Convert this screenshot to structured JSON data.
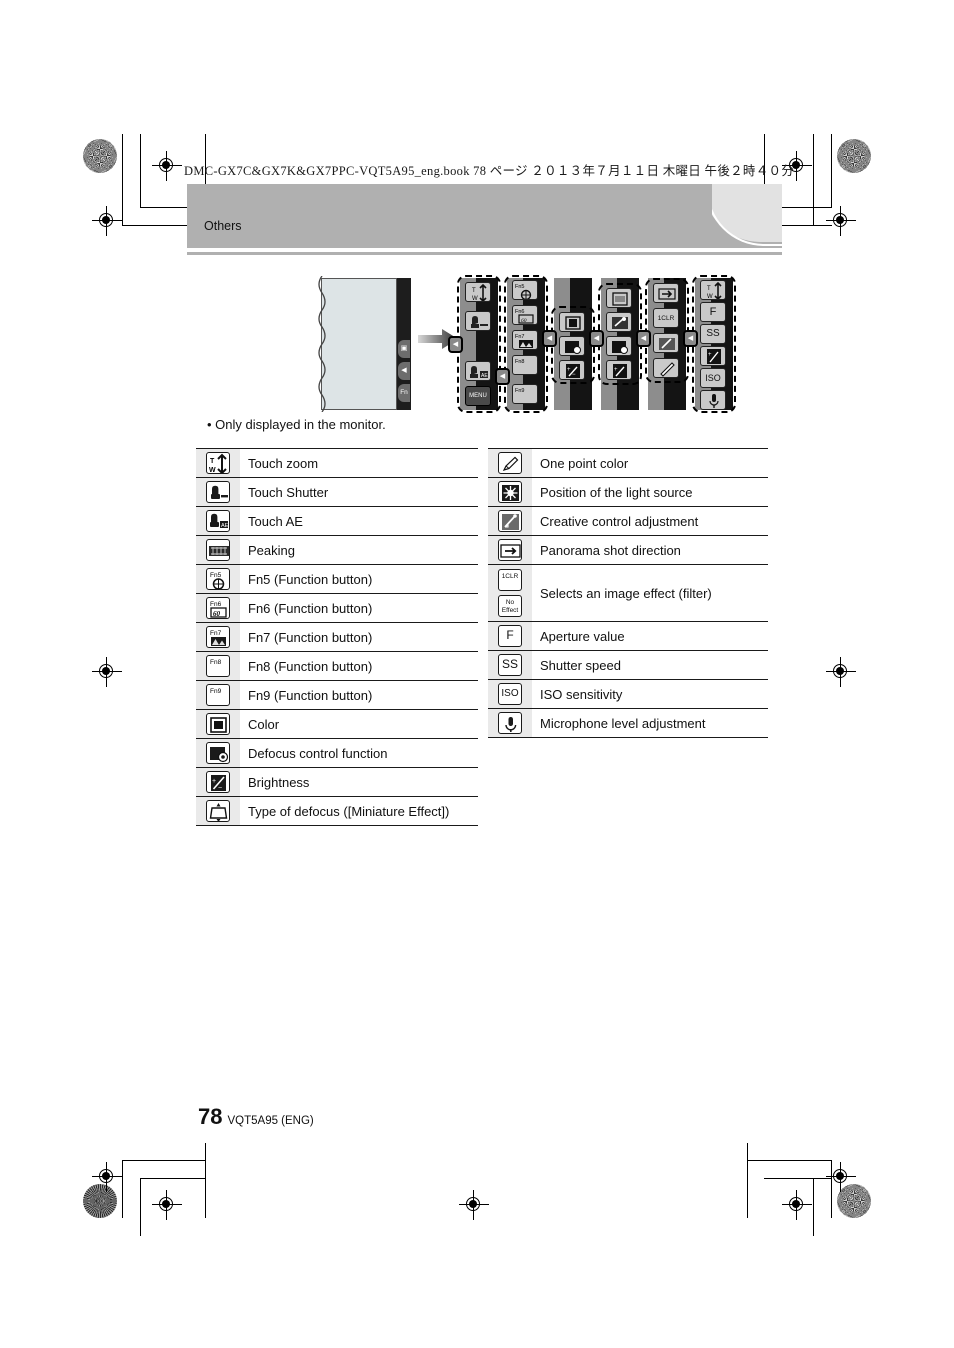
{
  "header": {
    "book_line": "DMC-GX7C&GX7K&GX7PPC-VQT5A95_eng.book   78 ページ   ２０１３年７月１１日   木曜日   午後２時４０分",
    "section": "Others"
  },
  "figure": {
    "monitor_buttons": [
      "▣",
      "◀",
      "Fn"
    ],
    "arrow": "arrow-right",
    "columns": [
      {
        "name": "column-1",
        "icons": [
          "T/W",
          "touch-shutter",
          "touch-ae",
          "MENU"
        ]
      },
      {
        "name": "column-2",
        "icons": [
          "Fn5",
          "Fn6",
          "Fn7",
          "Fn8",
          "Fn9"
        ]
      },
      {
        "name": "column-3",
        "icons": [
          "color",
          "defocus",
          "brightness"
        ]
      },
      {
        "name": "column-4",
        "icons": [
          "miniature",
          "one-point-color",
          "defocus",
          "brightness"
        ]
      },
      {
        "name": "column-5",
        "icons": [
          "panorama",
          "1CLR",
          "creative",
          "pen"
        ]
      },
      {
        "name": "column-6",
        "icons": [
          "T/W",
          "F",
          "SS",
          "EV",
          "ISO",
          "mic"
        ]
      }
    ]
  },
  "note": "• Only displayed in the monitor.",
  "left_table": {
    "rows": [
      {
        "icon": "touch-zoom-icon",
        "label": "Touch zoom"
      },
      {
        "icon": "touch-shutter-icon",
        "label": "Touch Shutter"
      },
      {
        "icon": "touch-ae-icon",
        "label": "Touch AE"
      },
      {
        "icon": "peaking-icon",
        "label": "Peaking"
      },
      {
        "icon": "fn5-icon",
        "label": "Fn5 (Function button)"
      },
      {
        "icon": "fn6-icon",
        "label": "Fn6 (Function button)"
      },
      {
        "icon": "fn7-icon",
        "label": "Fn7 (Function button)"
      },
      {
        "icon": "fn8-icon",
        "label": "Fn8 (Function button)"
      },
      {
        "icon": "fn9-icon",
        "label": "Fn9 (Function button)"
      },
      {
        "icon": "color-icon",
        "label": "Color"
      },
      {
        "icon": "defocus-control-icon",
        "label": "Defocus control function"
      },
      {
        "icon": "brightness-icon",
        "label": "Brightness"
      },
      {
        "icon": "type-of-defocus-icon",
        "label": "Type of defocus ([Miniature Effect])"
      }
    ]
  },
  "right_table": {
    "rows": [
      {
        "icon": "one-point-color-icon",
        "label": "One point color"
      },
      {
        "icon": "light-source-icon",
        "label": "Position of the light source"
      },
      {
        "icon": "creative-control-icon",
        "label": "Creative control adjustment"
      },
      {
        "icon": "panorama-direction-icon",
        "label": "Panorama shot direction"
      },
      {
        "icon": "image-effect-filter-icon",
        "label": "Selects an image effect (filter)",
        "icon_texts": [
          "1CLR",
          "No Effect"
        ]
      },
      {
        "icon": "aperture-icon",
        "label": "Aperture value",
        "icon_text": "F"
      },
      {
        "icon": "shutter-speed-icon",
        "label": "Shutter speed",
        "icon_text": "SS"
      },
      {
        "icon": "iso-icon",
        "label": "ISO sensitivity",
        "icon_text": "ISO"
      },
      {
        "icon": "microphone-level-icon",
        "label": "Microphone level adjustment"
      }
    ]
  },
  "footer": {
    "page_number": "78",
    "doc_code": "VQT5A95 (ENG)"
  },
  "colors": {
    "band": "#b0b0b0",
    "icon_cell": "#eaeaea",
    "screen": "#dde4e6"
  }
}
